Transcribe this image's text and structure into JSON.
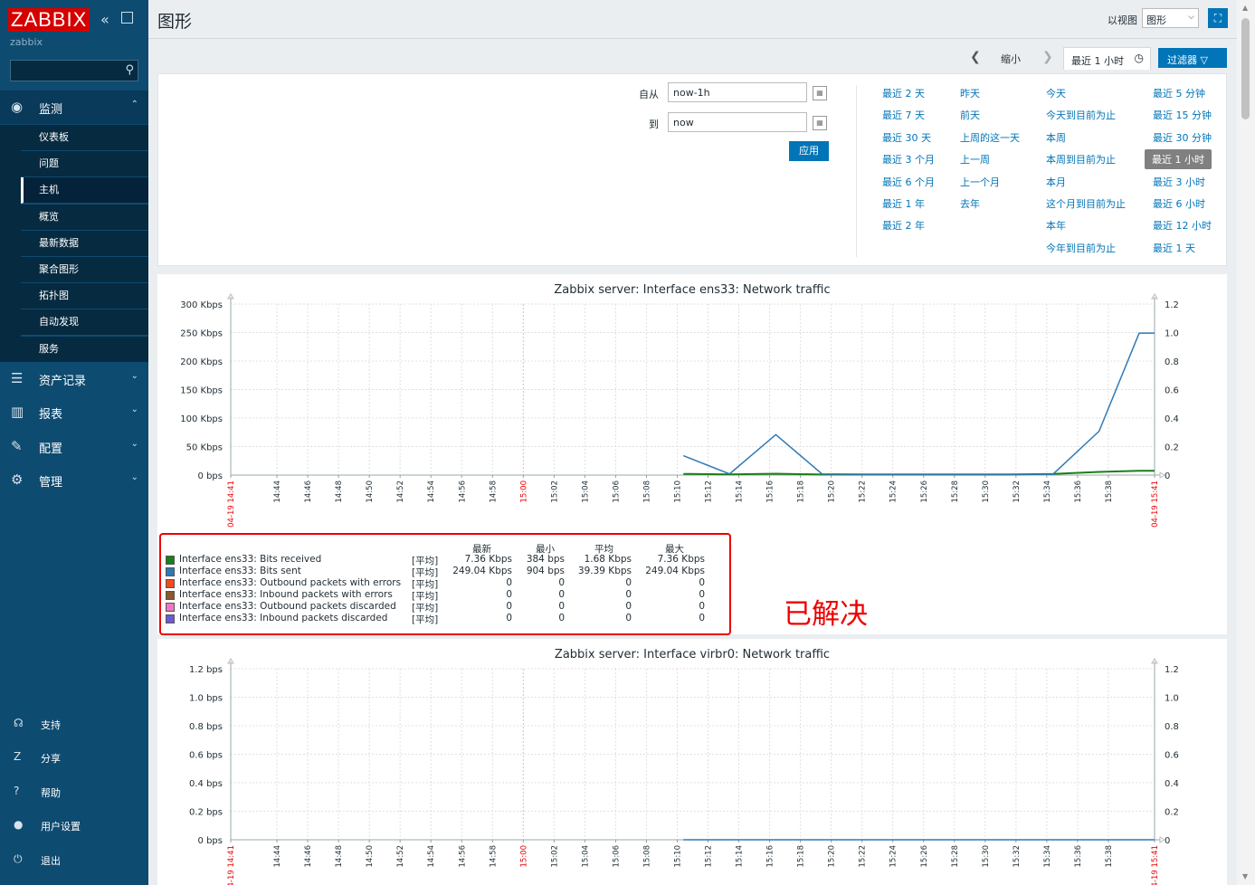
{
  "sidebar": {
    "logo": "ZABBIX",
    "server_name": "zabbix",
    "collapse_icon": "«",
    "sections": [
      {
        "label": "监测",
        "icon": "eye-icon",
        "glyph": "◉",
        "expanded": true
      },
      {
        "label": "资产记录",
        "icon": "list-icon",
        "glyph": "☰"
      },
      {
        "label": "报表",
        "icon": "bar-chart-icon",
        "glyph": "▥"
      },
      {
        "label": "配置",
        "icon": "wrench-icon",
        "glyph": "✎"
      },
      {
        "label": "管理",
        "icon": "gear-icon",
        "glyph": "⚙"
      }
    ],
    "monitoring_items": [
      "仪表板",
      "问题",
      "主机",
      "概览",
      "最新数据",
      "聚合图形",
      "拓扑图",
      "自动发现",
      "服务"
    ],
    "current_item": "主机",
    "footer": [
      {
        "label": "支持",
        "icon": "headset-icon",
        "glyph": "☊"
      },
      {
        "label": "分享",
        "icon": "share-icon",
        "glyph": "Z"
      },
      {
        "label": "帮助",
        "icon": "help-icon",
        "glyph": "?"
      },
      {
        "label": "用户设置",
        "icon": "user-icon",
        "glyph": "●"
      },
      {
        "label": "退出",
        "icon": "power-icon",
        "glyph": "⏻"
      }
    ]
  },
  "header": {
    "title": "图形",
    "view_as_label": "以视图",
    "view_as_value": "图形"
  },
  "timebar": {
    "zoom_out": "缩小",
    "period_tab": "最近 1 小时",
    "filter_button": "过滤器"
  },
  "filter": {
    "from_label": "自从",
    "from_value": "now-1h",
    "to_label": "到",
    "to_value": "now",
    "apply": "应用",
    "quick_ranges": [
      [
        "最近 2 天",
        "最近 7 天",
        "最近 30 天",
        "最近 3 个月",
        "最近 6 个月",
        "最近 1 年",
        "最近 2 年"
      ],
      [
        "昨天",
        "前天",
        "上周的这一天",
        "上一周",
        "上一个月",
        "去年"
      ],
      [
        "今天",
        "今天到目前为止",
        "本周",
        "本周到目前为止",
        "本月",
        "这个月到目前为止",
        "本年",
        "今年到目前为止"
      ],
      [
        "最近 5 分钟",
        "最近 15 分钟",
        "最近 30 分钟",
        "最近 1 小时",
        "最近 3 小时",
        "最近 6 小时",
        "最近 12 小时",
        "最近 1 天"
      ]
    ],
    "selected_range": "最近 1 小时"
  },
  "legend": {
    "headers": [
      "最新",
      "最小",
      "平均",
      "最大"
    ],
    "items": [
      {
        "name": "Interface ens33: Bits received",
        "func": "[平均]",
        "last": "7.36 Kbps",
        "min": "384 bps",
        "avg": "1.68 Kbps",
        "max": "7.36 Kbps",
        "color": "#1a7f1a"
      },
      {
        "name": "Interface ens33: Bits sent",
        "func": "[平均]",
        "last": "249.04 Kbps",
        "min": "904 bps",
        "avg": "39.39 Kbps",
        "max": "249.04 Kbps",
        "color": "#2e79b5"
      },
      {
        "name": "Interface ens33: Outbound packets with errors",
        "func": "[平均]",
        "last": "0",
        "min": "0",
        "avg": "0",
        "max": "0",
        "color": "#f44a1c"
      },
      {
        "name": "Interface ens33: Inbound packets with errors",
        "func": "[平均]",
        "last": "0",
        "min": "0",
        "avg": "0",
        "max": "0",
        "color": "#8a5a2a"
      },
      {
        "name": "Interface ens33: Outbound packets discarded",
        "func": "[平均]",
        "last": "0",
        "min": "0",
        "avg": "0",
        "max": "0",
        "color": "#f075c5"
      },
      {
        "name": "Interface ens33: Inbound packets discarded",
        "func": "[平均]",
        "last": "0",
        "min": "0",
        "avg": "0",
        "max": "0",
        "color": "#6a5ad6"
      }
    ]
  },
  "annotation": "已解决",
  "chart_data": [
    {
      "type": "line",
      "title": "Zabbix server: Interface ens33: Network traffic",
      "x_ticks": [
        "04-19 14:41",
        "14:44",
        "14:46",
        "14:48",
        "14:50",
        "14:52",
        "14:54",
        "14:56",
        "14:58",
        "15:00",
        "15:02",
        "15:04",
        "15:06",
        "15:08",
        "15:10",
        "15:12",
        "15:14",
        "15:16",
        "15:18",
        "15:20",
        "15:22",
        "15:24",
        "15:26",
        "15:28",
        "15:30",
        "15:32",
        "15:34",
        "15:36",
        "15:38",
        "04-19 15:41"
      ],
      "x_ticks_red": [
        "04-19 14:41",
        "15:00",
        "04-19 15:41"
      ],
      "y_left_ticks": [
        "0 bps",
        "50 Kbps",
        "100 Kbps",
        "150 Kbps",
        "200 Kbps",
        "250 Kbps",
        "300 Kbps"
      ],
      "y_right_ticks": [
        "0",
        "0.2",
        "0.4",
        "0.6",
        "0.8",
        "1.0",
        "1.2"
      ],
      "x_range_min": [
        0,
        60
      ],
      "y_range_kbps": [
        0,
        300
      ],
      "series": [
        {
          "name": "Interface ens33: Bits received",
          "color": "#1a7f1a",
          "points": [
            [
              29.4,
              2.1
            ],
            [
              32.4,
              1.2
            ],
            [
              35.4,
              2.4
            ],
            [
              38.4,
              1.0
            ],
            [
              41.4,
              1.0
            ],
            [
              44.4,
              1.0
            ],
            [
              47.4,
              1.0
            ],
            [
              50.4,
              1.0
            ],
            [
              53.4,
              2.0
            ],
            [
              56.4,
              5.5
            ],
            [
              59.0,
              7.4
            ],
            [
              60,
              7.4
            ]
          ]
        },
        {
          "name": "Interface ens33: Bits sent",
          "color": "#2e79b5",
          "points": [
            [
              29.4,
              34
            ],
            [
              32.4,
              2
            ],
            [
              35.4,
              71
            ],
            [
              38.4,
              2
            ],
            [
              41.4,
              1.5
            ],
            [
              44.4,
              1.5
            ],
            [
              47.4,
              1.5
            ],
            [
              50.4,
              1.5
            ],
            [
              53.4,
              1.5
            ],
            [
              56.4,
              77
            ],
            [
              59.0,
              249
            ],
            [
              60,
              249
            ]
          ]
        }
      ]
    },
    {
      "type": "line",
      "title": "Zabbix server: Interface virbr0: Network traffic",
      "x_ticks": [
        "04-19 14:41",
        "14:44",
        "14:46",
        "14:48",
        "14:50",
        "14:52",
        "14:54",
        "14:56",
        "14:58",
        "15:00",
        "15:02",
        "15:04",
        "15:06",
        "15:08",
        "15:10",
        "15:12",
        "15:14",
        "15:16",
        "15:18",
        "15:20",
        "15:22",
        "15:24",
        "15:26",
        "15:28",
        "15:30",
        "15:32",
        "15:34",
        "15:36",
        "15:38",
        "04-19 15:41"
      ],
      "x_ticks_red": [
        "04-19 14:41",
        "15:00",
        "04-19 15:41"
      ],
      "y_left_ticks": [
        "0 bps",
        "0.2 bps",
        "0.4 bps",
        "0.6 bps",
        "0.8 bps",
        "1.0 bps",
        "1.2 bps"
      ],
      "y_right_ticks": [
        "0",
        "0.2",
        "0.4",
        "0.6",
        "0.8",
        "1.0",
        "1.2"
      ],
      "x_range_min": [
        0,
        60
      ],
      "y_range_bps": [
        0,
        1.2
      ],
      "series": [
        {
          "name": "",
          "color": "#2e79b5",
          "points": [
            [
              29.4,
              0
            ],
            [
              60,
              0
            ]
          ]
        }
      ]
    }
  ]
}
